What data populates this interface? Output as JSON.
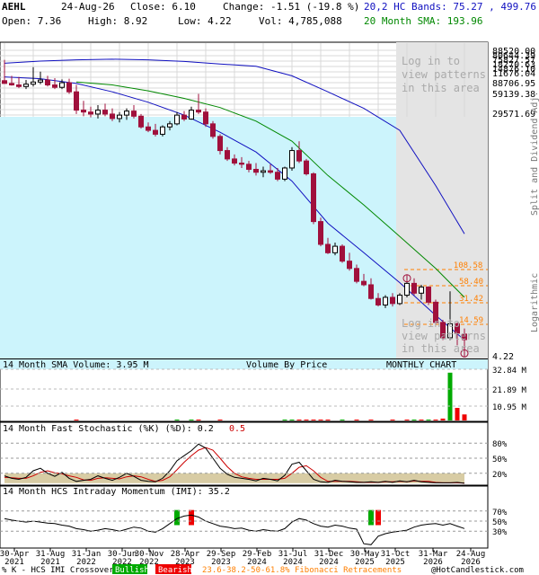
{
  "header": {
    "symbol": "AEHL",
    "date": "24-Aug-26",
    "close_label": "Close: 6.10",
    "change_label": "Change: -1.51 (-19.8 %)",
    "open_label": "Open: 7.36",
    "high_label": "High: 8.92",
    "low_label": "Low: 4.22",
    "vol_label": "Vol: 4,785,088",
    "bands_label": "20,2 HC Bands: 75.27 , 499.76",
    "sma_label": "20 Month SMA: 193.96"
  },
  "colors": {
    "bands": "#1010c0",
    "sma": "#008800",
    "candle_up": "#ffffff",
    "candle_down": "#a0103c",
    "shade_cyan": "#ccf4fc",
    "shade_gray": "#e4e4e4",
    "fib": "#ff7f00",
    "bullish": "#00aa00",
    "bearish": "#ee0000"
  },
  "watermarks": {
    "top": [
      "Log in to",
      "view patterns",
      "in this area"
    ],
    "bottom": [
      "Log in to",
      "view patterns",
      "in this area"
    ]
  },
  "right_axis": {
    "split_label": "Split and Dividend Adj.",
    "log_label": "Logarithmic"
  },
  "fib_lines": [
    "108.58",
    "58.40",
    "31.42",
    "14.59"
  ],
  "volume_panel": {
    "sma_label": "14 Month SMA Volume: 3.95 M",
    "vbp_label": "Volume By Price",
    "chart_type_label": "MONTHLY CHART",
    "ticks": [
      "32.84 M",
      "21.89 M",
      "10.95 M"
    ]
  },
  "stoch_panel": {
    "title": "14 Month Fast Stochastic (%K) (%D): 0.2",
    "d_value": "0.5",
    "ticks": [
      "80%",
      "50%",
      "20%"
    ]
  },
  "imi_panel": {
    "title": "14 Month HCS Intraday Momentum (IMI): 35.2",
    "ticks": [
      "70%",
      "50%",
      "30%"
    ]
  },
  "x_axis": {
    "labels": [
      [
        "30-Apr",
        "2021"
      ],
      [
        "31-Aug",
        "2021"
      ],
      [
        "31-Jan",
        "2022"
      ],
      [
        "30-Jun",
        "2022"
      ],
      [
        "30-Nov",
        "2022"
      ],
      [
        "28-Apr",
        "2023"
      ],
      [
        "29-Sep",
        "2023"
      ],
      [
        "29-Feb",
        "2024"
      ],
      [
        "31-Jul",
        "2024"
      ],
      [
        "31-Dec",
        "2024"
      ],
      [
        "30-May",
        "2025"
      ],
      [
        "31-Oct",
        "2025"
      ],
      [
        "31-Mar",
        "2026"
      ],
      [
        "24-Aug",
        "2026"
      ]
    ]
  },
  "footer": {
    "legend_prefix": "% K - HCS IMI Crossover:",
    "bullish": "Bullish",
    "bearish": "Bearish",
    "fib_text": "23.6-38.2-50-61.8% Fibonacci Retracements",
    "copyright": "@HotCandlestick.com"
  },
  "chart_data": {
    "type": "candlestick",
    "scale": "log",
    "price_tick_labels": [
      "88520.00",
      "80644.39",
      "75827.57",
      "18270.63",
      "14876.10",
      "11676.04",
      "88706.95",
      "59139.38",
      "29571.69",
      "4.22"
    ],
    "candles": [
      {
        "t": "2021-04",
        "o": 44000,
        "h": 90000,
        "l": 40000,
        "c": 40000
      },
      {
        "t": "2021-05",
        "o": 40000,
        "h": 52000,
        "l": 37000,
        "c": 38000
      },
      {
        "t": "2021-06",
        "o": 38000,
        "h": 50000,
        "l": 34000,
        "c": 36000
      },
      {
        "t": "2021-07",
        "o": 36000,
        "h": 45000,
        "l": 33000,
        "c": 39000
      },
      {
        "t": "2021-08",
        "o": 39000,
        "h": 70000,
        "l": 36000,
        "c": 42000
      },
      {
        "t": "2021-09",
        "o": 42000,
        "h": 60000,
        "l": 39000,
        "c": 45000
      },
      {
        "t": "2021-10",
        "o": 45000,
        "h": 52000,
        "l": 36000,
        "c": 38000
      },
      {
        "t": "2021-11",
        "o": 38000,
        "h": 48000,
        "l": 33000,
        "c": 35000
      },
      {
        "t": "2021-12",
        "o": 35000,
        "h": 46000,
        "l": 33000,
        "c": 41000
      },
      {
        "t": "2022-01",
        "o": 41000,
        "h": 47000,
        "l": 28000,
        "c": 30000
      },
      {
        "t": "2022-02",
        "o": 30000,
        "h": 38000,
        "l": 14000,
        "c": 16000
      },
      {
        "t": "2022-03",
        "o": 16000,
        "h": 22000,
        "l": 13000,
        "c": 15000
      },
      {
        "t": "2022-04",
        "o": 15000,
        "h": 18000,
        "l": 12500,
        "c": 14000
      },
      {
        "t": "2022-05",
        "o": 14000,
        "h": 19000,
        "l": 12000,
        "c": 16000
      },
      {
        "t": "2022-06",
        "o": 16000,
        "h": 20000,
        "l": 13000,
        "c": 14000
      },
      {
        "t": "2022-07",
        "o": 14000,
        "h": 17000,
        "l": 11000,
        "c": 12000
      },
      {
        "t": "2022-08",
        "o": 12000,
        "h": 15000,
        "l": 10500,
        "c": 13500
      },
      {
        "t": "2022-09",
        "o": 13500,
        "h": 17000,
        "l": 11500,
        "c": 15500
      },
      {
        "t": "2022-10",
        "o": 15500,
        "h": 19000,
        "l": 12000,
        "c": 13000
      },
      {
        "t": "2022-11",
        "o": 13000,
        "h": 14000,
        "l": 8500,
        "c": 9000
      },
      {
        "t": "2022-12",
        "o": 9000,
        "h": 10500,
        "l": 7500,
        "c": 8000
      },
      {
        "t": "2023-01",
        "o": 8000,
        "h": 10000,
        "l": 6500,
        "c": 7000
      },
      {
        "t": "2023-02",
        "o": 7000,
        "h": 9500,
        "l": 6500,
        "c": 9000
      },
      {
        "t": "2023-03",
        "o": 9000,
        "h": 11000,
        "l": 8000,
        "c": 10000
      },
      {
        "t": "2023-04",
        "o": 10000,
        "h": 15000,
        "l": 9500,
        "c": 13500
      },
      {
        "t": "2023-05",
        "o": 13500,
        "h": 15500,
        "l": 11000,
        "c": 11800
      },
      {
        "t": "2023-06",
        "o": 11800,
        "h": 18000,
        "l": 11500,
        "c": 16000
      },
      {
        "t": "2023-07",
        "o": 16000,
        "h": 28000,
        "l": 14000,
        "c": 15000
      },
      {
        "t": "2023-08",
        "o": 15000,
        "h": 17000,
        "l": 9000,
        "c": 10000
      },
      {
        "t": "2023-09",
        "o": 10000,
        "h": 11000,
        "l": 6000,
        "c": 6500
      },
      {
        "t": "2023-10",
        "o": 6500,
        "h": 7000,
        "l": 3500,
        "c": 4000
      },
      {
        "t": "2023-11",
        "o": 4000,
        "h": 4500,
        "l": 2800,
        "c": 3000
      },
      {
        "t": "2023-12",
        "o": 3000,
        "h": 3500,
        "l": 2400,
        "c": 2600
      },
      {
        "t": "2024-01",
        "o": 2600,
        "h": 3200,
        "l": 2200,
        "c": 2500
      },
      {
        "t": "2024-02",
        "o": 2500,
        "h": 2800,
        "l": 1900,
        "c": 2100
      },
      {
        "t": "2024-03",
        "o": 2100,
        "h": 2600,
        "l": 1700,
        "c": 1900
      },
      {
        "t": "2024-04",
        "o": 1900,
        "h": 2300,
        "l": 1600,
        "c": 2000
      },
      {
        "t": "2024-05",
        "o": 2000,
        "h": 2500,
        "l": 1800,
        "c": 1900
      },
      {
        "t": "2024-06",
        "o": 1900,
        "h": 2200,
        "l": 1400,
        "c": 1500
      },
      {
        "t": "2024-07",
        "o": 1500,
        "h": 2300,
        "l": 1400,
        "c": 2200
      },
      {
        "t": "2024-08",
        "o": 2200,
        "h": 4500,
        "l": 2000,
        "c": 4000
      },
      {
        "t": "2024-09",
        "o": 4000,
        "h": 5500,
        "l": 2600,
        "c": 2800
      },
      {
        "t": "2024-10",
        "o": 2800,
        "h": 3000,
        "l": 1700,
        "c": 1800
      },
      {
        "t": "2024-11",
        "o": 1800,
        "h": 1900,
        "l": 320,
        "c": 350
      },
      {
        "t": "2024-12",
        "o": 350,
        "h": 400,
        "l": 150,
        "c": 160
      },
      {
        "t": "2025-01",
        "o": 160,
        "h": 200,
        "l": 115,
        "c": 120
      },
      {
        "t": "2025-02",
        "o": 120,
        "h": 170,
        "l": 110,
        "c": 150
      },
      {
        "t": "2025-03",
        "o": 150,
        "h": 160,
        "l": 85,
        "c": 90
      },
      {
        "t": "2025-04",
        "o": 90,
        "h": 120,
        "l": 65,
        "c": 70
      },
      {
        "t": "2025-05",
        "o": 70,
        "h": 80,
        "l": 42,
        "c": 45
      },
      {
        "t": "2025-06",
        "o": 45,
        "h": 58,
        "l": 38,
        "c": 40
      },
      {
        "t": "2025-07",
        "o": 40,
        "h": 50,
        "l": 24,
        "c": 25
      },
      {
        "t": "2025-08",
        "o": 25,
        "h": 30,
        "l": 19,
        "c": 20
      },
      {
        "t": "2025-09",
        "o": 20,
        "h": 28,
        "l": 18,
        "c": 26
      },
      {
        "t": "2025-10",
        "o": 26,
        "h": 30,
        "l": 19,
        "c": 21
      },
      {
        "t": "2025-11",
        "o": 21,
        "h": 30,
        "l": 20,
        "c": 28
      },
      {
        "t": "2025-12",
        "o": 28,
        "h": 45,
        "l": 26,
        "c": 42
      },
      {
        "t": "2026-01",
        "o": 42,
        "h": 50,
        "l": 28,
        "c": 30
      },
      {
        "t": "2026-02",
        "o": 30,
        "h": 40,
        "l": 24,
        "c": 37
      },
      {
        "t": "2026-03",
        "o": 37,
        "h": 38,
        "l": 20,
        "c": 22
      },
      {
        "t": "2026-04",
        "o": 22,
        "h": 24,
        "l": 10,
        "c": 11
      },
      {
        "t": "2026-05",
        "o": 11,
        "h": 12,
        "l": 6,
        "c": 6.5
      },
      {
        "t": "2026-06",
        "o": 6.5,
        "h": 32,
        "l": 6,
        "c": 10.5
      },
      {
        "t": "2026-07",
        "o": 10.5,
        "h": 11,
        "l": 5,
        "c": 7.6
      },
      {
        "t": "2026-08",
        "o": 7.36,
        "h": 8.92,
        "l": 4.22,
        "c": 6.1
      }
    ],
    "markers": [
      {
        "t": "2025-12",
        "price": 50
      },
      {
        "t": "2026-08",
        "price": 3.8
      }
    ],
    "sma": [
      {
        "i": 10,
        "v": 42000
      },
      {
        "i": 15,
        "v": 38000
      },
      {
        "i": 20,
        "v": 31000
      },
      {
        "i": 25,
        "v": 24000
      },
      {
        "i": 30,
        "v": 17500
      },
      {
        "i": 35,
        "v": 11000
      },
      {
        "i": 40,
        "v": 5500
      },
      {
        "i": 45,
        "v": 1700
      },
      {
        "i": 50,
        "v": 620
      },
      {
        "i": 55,
        "v": 210
      },
      {
        "i": 60,
        "v": 70
      },
      {
        "i": 64,
        "v": 26
      }
    ],
    "upper_band": [
      {
        "i": 0,
        "v": 80000
      },
      {
        "i": 5,
        "v": 86000
      },
      {
        "i": 10,
        "v": 90000
      },
      {
        "i": 15,
        "v": 92000
      },
      {
        "i": 20,
        "v": 90000
      },
      {
        "i": 25,
        "v": 85000
      },
      {
        "i": 30,
        "v": 78000
      },
      {
        "i": 35,
        "v": 72000
      },
      {
        "i": 40,
        "v": 52000
      },
      {
        "i": 45,
        "v": 30000
      },
      {
        "i": 50,
        "v": 17000
      },
      {
        "i": 55,
        "v": 8000
      },
      {
        "i": 60,
        "v": 1200
      },
      {
        "i": 64,
        "v": 230
      }
    ],
    "lower_band": [
      {
        "i": 0,
        "v": 50000
      },
      {
        "i": 5,
        "v": 47000
      },
      {
        "i": 10,
        "v": 40000
      },
      {
        "i": 15,
        "v": 30000
      },
      {
        "i": 20,
        "v": 21000
      },
      {
        "i": 25,
        "v": 13500
      },
      {
        "i": 30,
        "v": 7500
      },
      {
        "i": 35,
        "v": 3800
      },
      {
        "i": 40,
        "v": 1400
      },
      {
        "i": 45,
        "v": 330
      },
      {
        "i": 50,
        "v": 120
      },
      {
        "i": 55,
        "v": 43
      },
      {
        "i": 60,
        "v": 14
      },
      {
        "i": 64,
        "v": 6
      }
    ],
    "volume_m": [
      0,
      0,
      0,
      0,
      0,
      0,
      0,
      0,
      0,
      0,
      0.1,
      0,
      0,
      0,
      0,
      0,
      0,
      0,
      0,
      0,
      0,
      0,
      0,
      0,
      0.1,
      0,
      0.1,
      0.2,
      0,
      0,
      0.1,
      0,
      0,
      0,
      0,
      0,
      0,
      0,
      0,
      0.1,
      0.4,
      0.3,
      0.2,
      0.3,
      0.2,
      0.1,
      0,
      0.1,
      0,
      0.1,
      0,
      0.2,
      0,
      0,
      0.1,
      0,
      0.3,
      0.2,
      0.1,
      0.2,
      0.5,
      1.5,
      38,
      10,
      4.8
    ],
    "volume_up": [
      0,
      0,
      0,
      0,
      0,
      0,
      0,
      0,
      0,
      0,
      0,
      0,
      0,
      0,
      0,
      0,
      0,
      0,
      0,
      0,
      0,
      0,
      0,
      0,
      1,
      0,
      1,
      0,
      0,
      0,
      0,
      0,
      0,
      0,
      0,
      0,
      0,
      0,
      0,
      1,
      1,
      0,
      0,
      0,
      0,
      0,
      0,
      1,
      0,
      0,
      0,
      0,
      0,
      0,
      0,
      0,
      0,
      1,
      0,
      1,
      0,
      0,
      1,
      0,
      0
    ],
    "stoch_k": [
      15,
      10,
      8,
      12,
      25,
      30,
      20,
      14,
      22,
      10,
      4,
      6,
      8,
      15,
      10,
      6,
      12,
      20,
      14,
      6,
      4,
      3,
      10,
      25,
      45,
      55,
      65,
      78,
      70,
      50,
      30,
      18,
      12,
      10,
      8,
      5,
      10,
      8,
      5,
      16,
      38,
      42,
      25,
      8,
      3,
      2,
      6,
      4,
      3,
      2,
      2,
      3,
      2,
      4,
      2,
      5,
      3,
      6,
      3,
      2,
      1,
      1,
      1,
      2,
      0.2
    ],
    "stoch_d": [
      12,
      11,
      10,
      10,
      15,
      22,
      25,
      21,
      19,
      15,
      12,
      7,
      6,
      10,
      11,
      10,
      9,
      13,
      15,
      13,
      8,
      4,
      6,
      13,
      27,
      42,
      55,
      66,
      71,
      66,
      50,
      33,
      20,
      13,
      10,
      8,
      8,
      8,
      8,
      10,
      20,
      32,
      35,
      25,
      12,
      4,
      4,
      4,
      4,
      3,
      2,
      2,
      2,
      3,
      3,
      4,
      3,
      5,
      4,
      4,
      2,
      1,
      1,
      1,
      0.5
    ],
    "imi": [
      55,
      52,
      50,
      48,
      50,
      48,
      46,
      45,
      42,
      40,
      35,
      33,
      30,
      32,
      35,
      33,
      30,
      34,
      38,
      36,
      30,
      28,
      35,
      45,
      55,
      60,
      62,
      58,
      50,
      45,
      40,
      38,
      35,
      36,
      32,
      30,
      33,
      31,
      30,
      35,
      48,
      55,
      52,
      45,
      40,
      38,
      42,
      40,
      36,
      34,
      5,
      3,
      20,
      25,
      28,
      30,
      32,
      38,
      42,
      44,
      45,
      42,
      45,
      40,
      35.2
    ],
    "imi_bull_idx": [
      24,
      51
    ],
    "imi_bear_idx": [
      26,
      52
    ],
    "stoch_band": [
      20,
      80
    ]
  }
}
